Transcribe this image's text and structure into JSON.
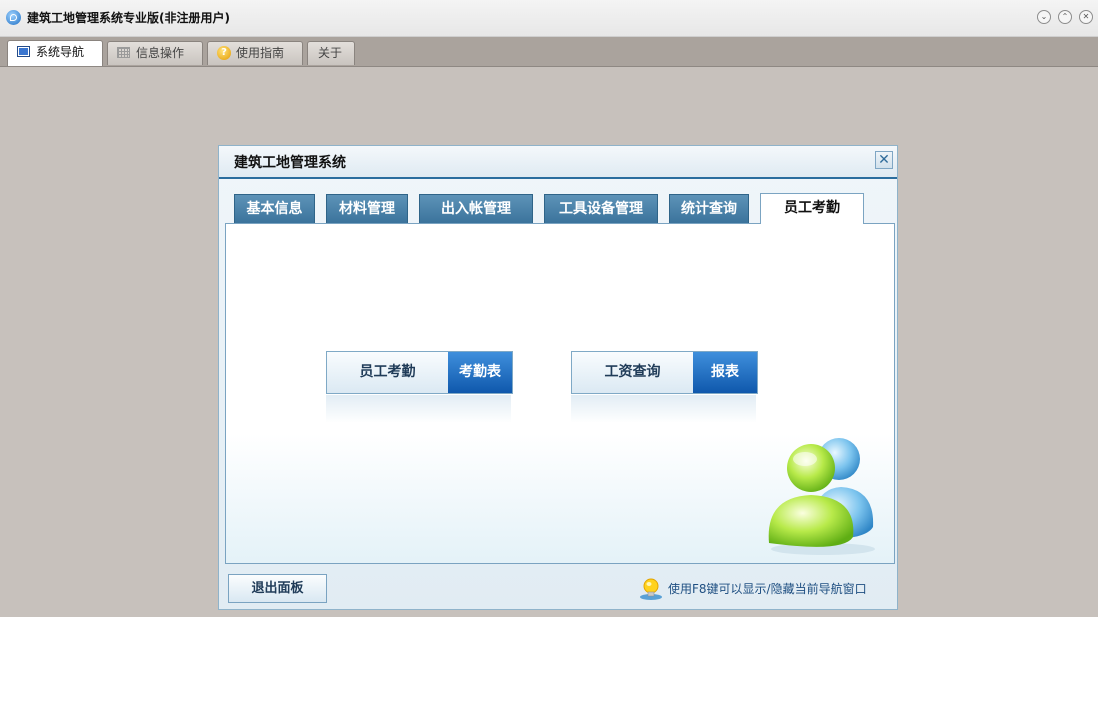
{
  "window": {
    "title": "建筑工地管理系统专业版(非注册用户)",
    "controls": [
      "⌄",
      "⌃",
      "✕"
    ]
  },
  "top_tabs": [
    {
      "label": "系统导航",
      "icon": "window-icon",
      "active": true
    },
    {
      "label": "信息操作",
      "icon": "grid-icon",
      "active": false
    },
    {
      "label": "使用指南",
      "icon": "help-icon",
      "active": false
    },
    {
      "label": "关于",
      "icon": "",
      "active": false
    }
  ],
  "dialog": {
    "title": "建筑工地管理系统",
    "close_symbol": "✕",
    "tabs": [
      "基本信息",
      "材料管理",
      "出入帐管理",
      "工具设备管理",
      "统计查询",
      "员工考勤"
    ],
    "active_tab": "员工考勤",
    "actions": [
      {
        "label": "员工考勤",
        "button": "考勤表"
      },
      {
        "label": "工资查询",
        "button": "报表"
      }
    ],
    "exit_button": "退出面板",
    "hint": "使用F8键可以显示/隐藏当前导航窗口"
  },
  "colors": {
    "accent": "#2a6d9e",
    "tab_blue": "#4a82ab",
    "action_button": "#1565b8",
    "workspace": "#c7c1bc"
  }
}
